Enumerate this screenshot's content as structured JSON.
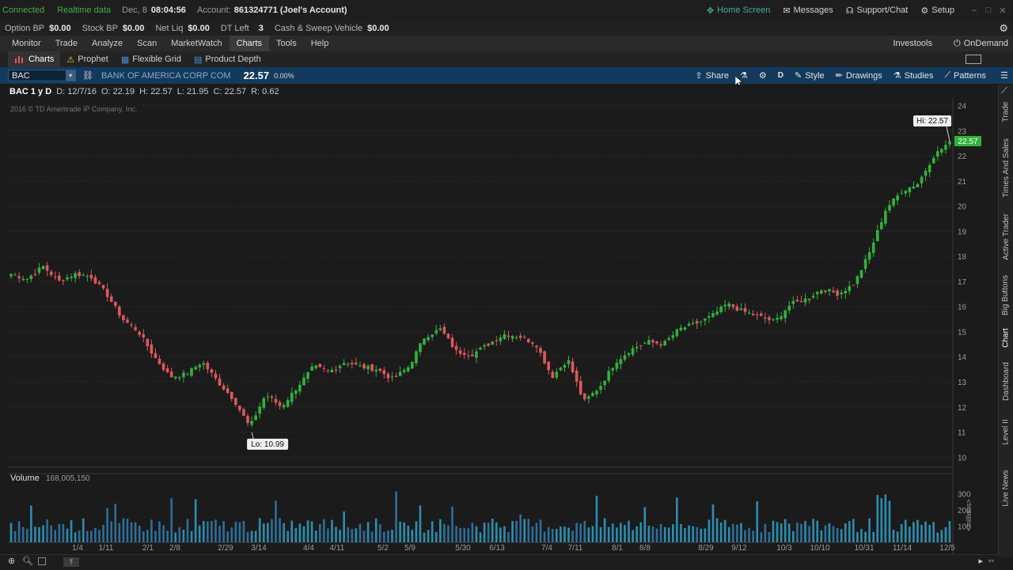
{
  "status": {
    "connected": "Connected",
    "realtime": "Realtime data",
    "date": "Dec, 8",
    "time": "08:04:56",
    "account_label": "Account:",
    "account_value": "861324771 (Joel's Account)",
    "home_screen": "Home Screen",
    "messages": "Messages",
    "support": "Support/Chat",
    "setup": "Setup"
  },
  "account_bar": [
    {
      "label": "Option BP",
      "value": "$0.00"
    },
    {
      "label": "Stock BP",
      "value": "$0.00"
    },
    {
      "label": "Net Liq",
      "value": "$0.00"
    },
    {
      "label": "DT Left",
      "value": "3"
    },
    {
      "label": "Cash & Sweep Vehicle",
      "value": "$0.00"
    }
  ],
  "nav": {
    "tabs": [
      "Monitor",
      "Trade",
      "Analyze",
      "Scan",
      "MarketWatch",
      "Charts",
      "Tools",
      "Help"
    ],
    "selected": "Charts",
    "investools": "Investools",
    "ondemand": "OnDemand"
  },
  "subnav": {
    "tabs": [
      "Charts",
      "Prophet",
      "Flexible Grid",
      "Product Depth"
    ]
  },
  "chartbar": {
    "symbol": "BAC",
    "company": "BANK OF AMERICA CORP COM",
    "price": "22.57",
    "change": "0.00%",
    "share": "Share",
    "aggregation": "D",
    "style": "Style",
    "drawings": "Drawings",
    "studies": "Studies",
    "patterns": "Patterns"
  },
  "ohlc": {
    "title": "BAC 1 y D",
    "date": "D: 12/7/16",
    "open": "O: 22.19",
    "high": "H: 22.57",
    "low": "L: 21.95",
    "close": "C: 22.57",
    "range": "R: 0.62"
  },
  "copyright": "2016 © TD Ameritrade IP Company, Inc.",
  "volume_panel": {
    "label": "Volume",
    "value": "168,005,150",
    "unit": "<millions>"
  },
  "sidebar_tabs": [
    "Trade",
    "Times And Sales",
    "Active Trader",
    "Big Buttons",
    "Chart",
    "Dashboard",
    "Level II",
    "Live News"
  ],
  "colors": {
    "up": "#2fb33b",
    "down": "#e0575b",
    "price_tag": "#2fb33b",
    "chart_bg": "#1b1b1b",
    "grid": "#2e2e2e"
  },
  "chart_data": {
    "type": "candlestick",
    "title": "",
    "xlabel": "",
    "ylabel": "",
    "ylim": [
      10,
      24
    ],
    "y_ticks": [
      10,
      11,
      12,
      13,
      14,
      15,
      16,
      17,
      18,
      19,
      20,
      21,
      22,
      23,
      24
    ],
    "x_ticks": [
      "1/4",
      "1/11",
      "2/1",
      "2/8",
      "2/29",
      "3/14",
      "4/4",
      "4/11",
      "5/2",
      "5/9",
      "5/30",
      "6/13",
      "7/4",
      "7/11",
      "8/1",
      "8/8",
      "8/29",
      "9/12",
      "10/3",
      "10/10",
      "10/31",
      "11/14",
      "12/5"
    ],
    "close_path": [
      17.3,
      17.1,
      17.6,
      17.0,
      17.3,
      17.2,
      16.5,
      15.5,
      15.0,
      14.0,
      13.2,
      13.3,
      13.8,
      13.0,
      12.3,
      11.2,
      12.5,
      12.0,
      12.8,
      13.6,
      13.4,
      13.8,
      13.6,
      13.5,
      13.1,
      13.6,
      14.8,
      15.1,
      14.2,
      14.1,
      14.5,
      14.9,
      14.8,
      14.5,
      13.2,
      13.9,
      12.2,
      12.8,
      13.8,
      14.3,
      14.6,
      14.5,
      15.1,
      15.3,
      15.6,
      16.1,
      15.8,
      15.6,
      15.4,
      16.1,
      16.3,
      16.7,
      16.5,
      16.9,
      18.2,
      19.9,
      20.6,
      20.9,
      22.0,
      22.57
    ],
    "hi": 22.57,
    "lo": 10.99,
    "last": 22.57,
    "volume_ticks": [
      100,
      200,
      300
    ],
    "volume_unit": "millions"
  }
}
